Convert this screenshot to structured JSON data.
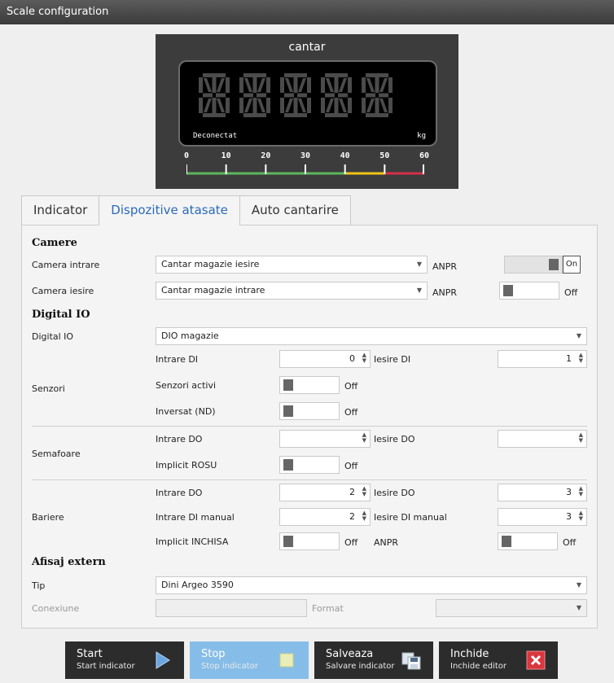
{
  "window": {
    "title": "Scale configuration"
  },
  "display": {
    "title": "cantar",
    "status": "Deconectat",
    "unit": "kg",
    "ticks": [
      "0",
      "10",
      "20",
      "30",
      "40",
      "50",
      "60"
    ],
    "colors": {
      "green": "#5cb85c",
      "yellow": "#f0c419",
      "red": "#d6304a",
      "accent": "#2a6ab8"
    }
  },
  "tabs": [
    {
      "label": "Indicator",
      "active": false
    },
    {
      "label": "Dispozitive atasate",
      "active": true
    },
    {
      "label": "Auto cantarire",
      "active": false
    }
  ],
  "camere": {
    "heading": "Camere",
    "intrare": {
      "label": "Camera intrare",
      "value": "Cantar magazie iesire",
      "anpr_label": "ANPR",
      "toggle_text": "On",
      "on": true
    },
    "iesire": {
      "label": "Camera iesire",
      "value": "Cantar magazie intrare",
      "anpr_label": "ANPR",
      "toggle_text": "Off",
      "on": false
    }
  },
  "digital_io": {
    "heading": "Digital IO",
    "label": "Digital IO",
    "value": "DIO magazie",
    "senzori": {
      "label": "Senzori",
      "intrare_di_label": "Intrare DI",
      "intrare_di_value": "0",
      "iesire_di_label": "Iesire DI",
      "iesire_di_value": "1",
      "activi_label": "Senzori activi",
      "activi_text": "Off",
      "inversat_label": "Inversat (ND)",
      "inversat_text": "Off"
    },
    "semafoare": {
      "label": "Semafoare",
      "intrare_do_label": "Intrare DO",
      "intrare_do_value": "",
      "iesire_do_label": "Iesire DO",
      "iesire_do_value": "",
      "implicit_label": "Implicit ROSU",
      "implicit_text": "Off"
    },
    "bariere": {
      "label": "Bariere",
      "intrare_do_label": "Intrare DO",
      "intrare_do_value": "2",
      "iesire_do_label": "Iesire DO",
      "iesire_do_value": "3",
      "intrare_di_manual_label": "Intrare DI manual",
      "intrare_di_manual_value": "2",
      "iesire_di_manual_label": "Iesire DI manual",
      "iesire_di_manual_value": "3",
      "implicit_label": "Implicit INCHISA",
      "implicit_text": "Off",
      "anpr_label": "ANPR",
      "anpr_text": "Off"
    }
  },
  "afisaj": {
    "heading": "Afisaj extern",
    "tip_label": "Tip",
    "tip_value": "Dini Argeo 3590",
    "conexiune_label": "Conexiune",
    "conexiune_value": "",
    "format_label": "Format",
    "format_value": ""
  },
  "buttons": [
    {
      "title": "Start",
      "subtitle": "Start indicator",
      "icon": "play-icon"
    },
    {
      "title": "Stop",
      "subtitle": "Stop indicator",
      "icon": "stop-icon"
    },
    {
      "title": "Salveaza",
      "subtitle": "Salvare indicator",
      "icon": "save-icon"
    },
    {
      "title": "Inchide",
      "subtitle": "Inchide editor",
      "icon": "close-icon"
    }
  ]
}
